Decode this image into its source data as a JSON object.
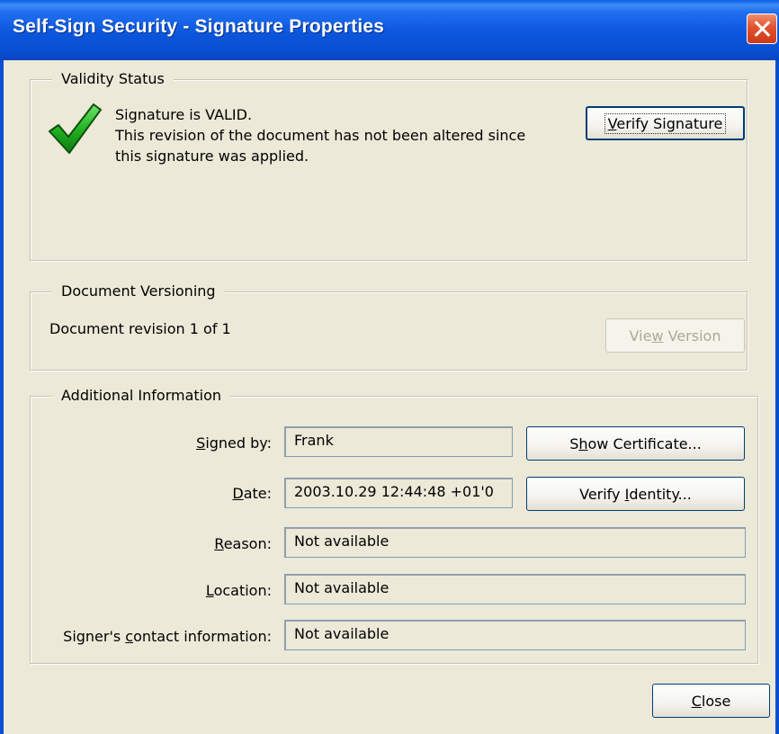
{
  "window": {
    "title": "Self-Sign Security - Signature Properties"
  },
  "validity": {
    "group_label": "Validity Status",
    "status_line1": "Signature is VALID.",
    "status_line2": "This revision of the document has not been altered since",
    "status_line3": "this signature was applied.",
    "verify_signature_pre": "",
    "verify_signature_u": "V",
    "verify_signature_post": "erify Signature",
    "icon": "checkmark-icon"
  },
  "versioning": {
    "group_label": "Document Versioning",
    "revision_text": "Document revision 1 of 1",
    "view_version_pre": "Vie",
    "view_version_u": "w",
    "view_version_post": " Version"
  },
  "additional": {
    "group_label": "Additional Information",
    "signed_by_pre": "",
    "signed_by_u": "S",
    "signed_by_post": "igned by:",
    "signed_by_value": "Frank",
    "date_pre": "",
    "date_u": "D",
    "date_post": "ate:",
    "date_value": "2003.10.29 12:44:48 +01'0",
    "reason_pre": "",
    "reason_u": "R",
    "reason_post": "eason:",
    "reason_value": "Not available",
    "location_pre": "",
    "location_u": "L",
    "location_post": "ocation:",
    "location_value": "Not available",
    "contact_pre": "Signer's ",
    "contact_u": "c",
    "contact_post": "ontact information:",
    "contact_value": "Not available",
    "show_certificate_pre": "S",
    "show_certificate_u": "h",
    "show_certificate_post": "ow Certificate...",
    "verify_identity_pre": "Verify ",
    "verify_identity_u": "I",
    "verify_identity_post": "dentity..."
  },
  "footer": {
    "close_pre": "",
    "close_u": "C",
    "close_post": "lose"
  }
}
